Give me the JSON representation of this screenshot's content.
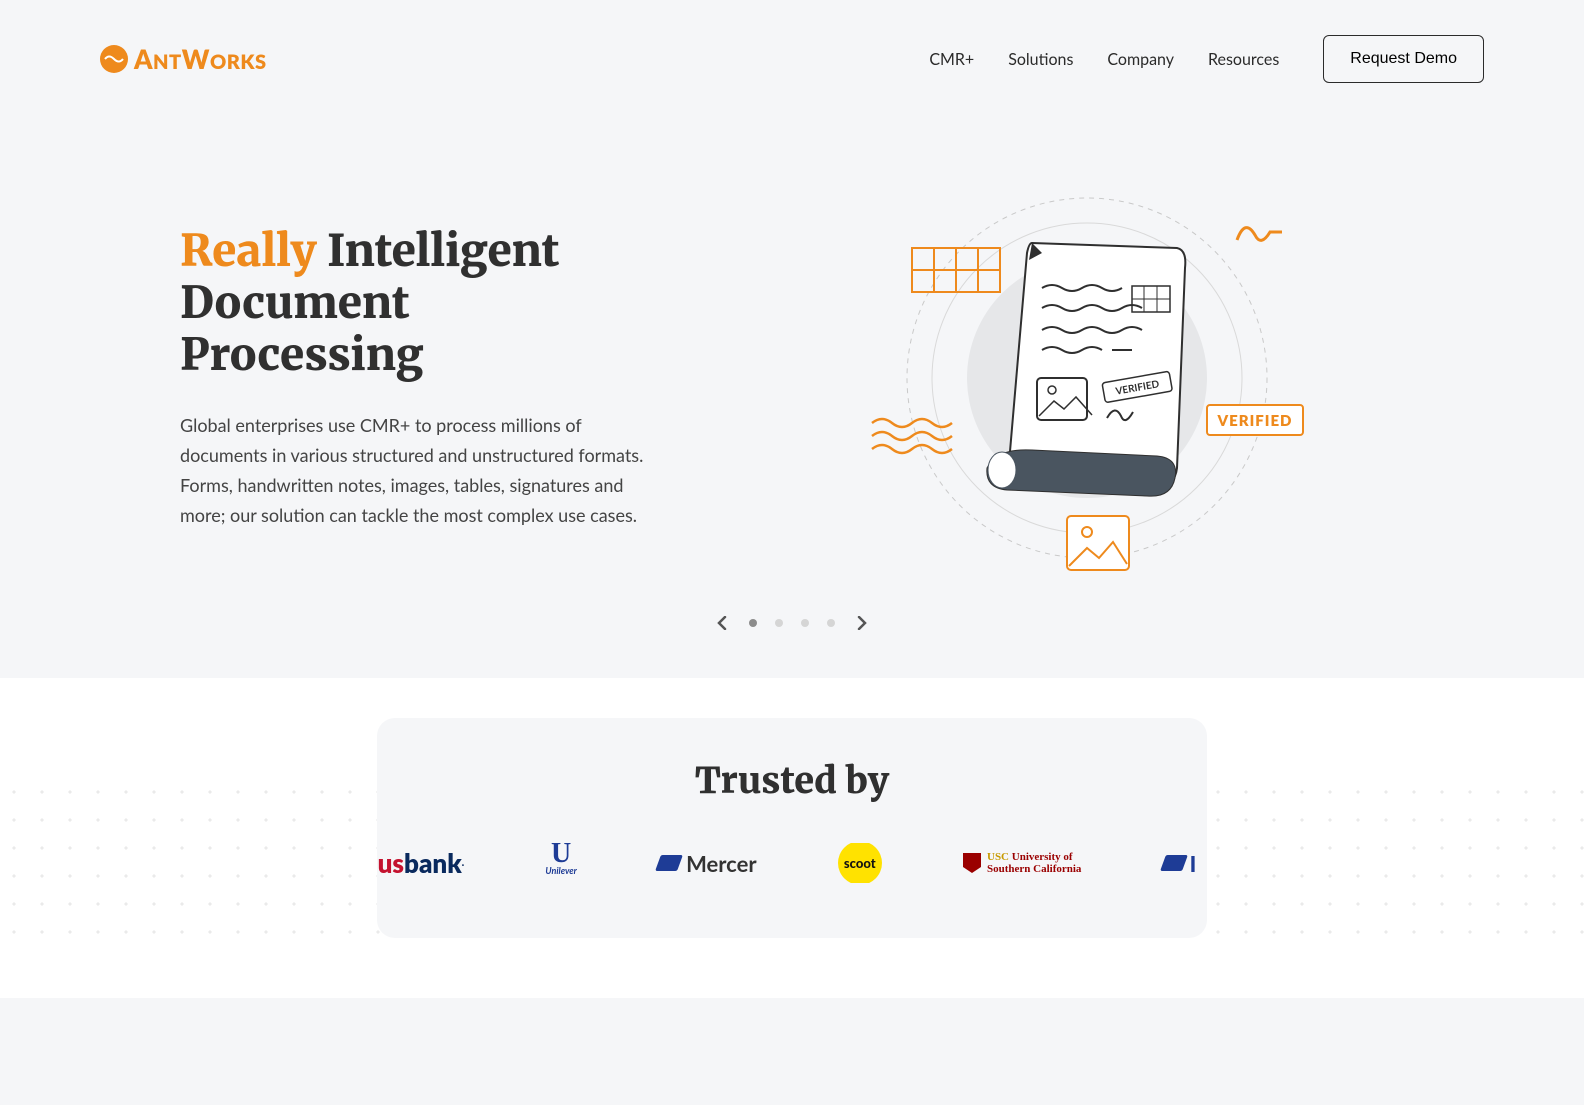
{
  "brand": {
    "name": "ANTWORKS"
  },
  "nav": {
    "items": [
      "CMR+",
      "Solutions",
      "Company",
      "Resources"
    ],
    "cta": "Request Demo"
  },
  "hero": {
    "title_accent": "Really",
    "title_rest_1": "Intelligent",
    "title_rest_2": "Document Processing",
    "description": "Global enterprises use CMR+ to process millions of documents in various structured and unstructured formats. Forms, handwritten notes, images, tables, signatures and more; our solution can tackle the most complex use cases.",
    "verified_badge": "VERIFIED",
    "stamp_text": "VERIFIED"
  },
  "carousel": {
    "slide_count": 4,
    "active_index": 0
  },
  "trusted": {
    "heading": "Trusted by",
    "clients": [
      {
        "id": "usbank",
        "display": "usbank"
      },
      {
        "id": "unilever",
        "display": "Unilever"
      },
      {
        "id": "mercer",
        "display": "Mercer"
      },
      {
        "id": "scoot",
        "display": "scoot"
      },
      {
        "id": "usc",
        "display": "USC University of Southern California"
      },
      {
        "id": "partial",
        "display": ""
      }
    ]
  }
}
